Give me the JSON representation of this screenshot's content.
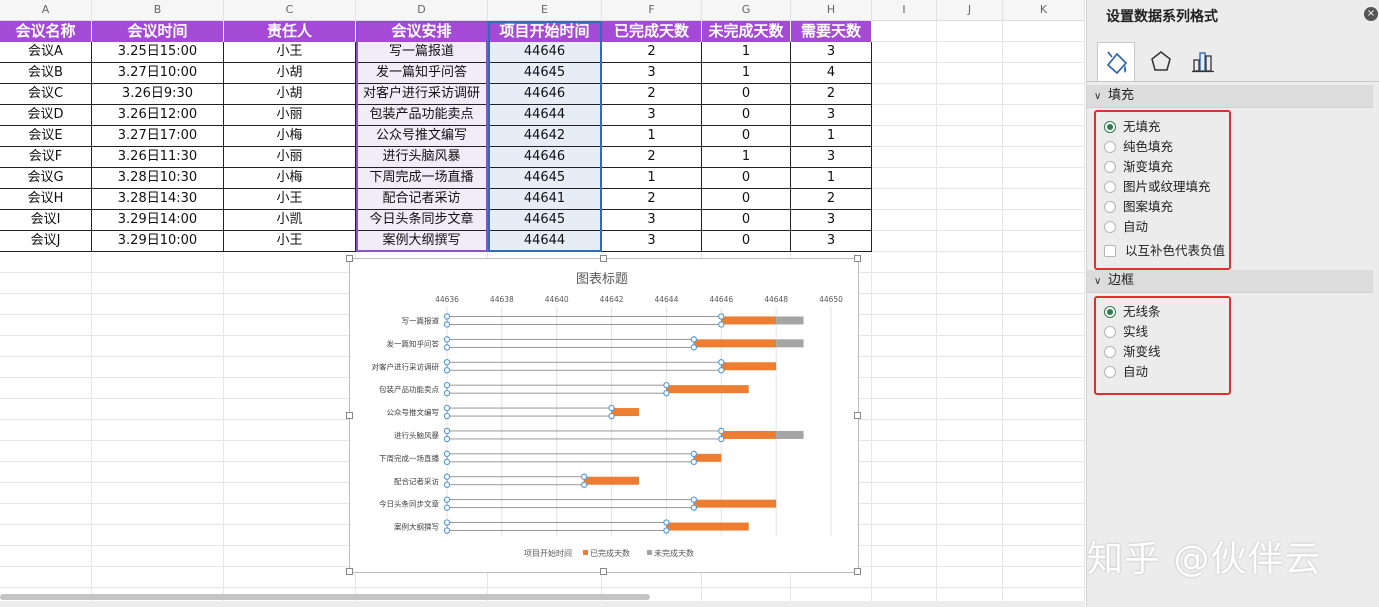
{
  "columns": [
    "A",
    "B",
    "C",
    "D",
    "E",
    "F",
    "G",
    "H",
    "I",
    "J",
    "K"
  ],
  "table": {
    "headers": [
      "会议名称",
      "会议时间",
      "责任人",
      "会议安排",
      "项目开始时间",
      "已完成天数",
      "未完成天数",
      "需要天数"
    ],
    "rows": [
      [
        "会议A",
        "3.25日15:00",
        "小王",
        "写一篇报道",
        "44646",
        "2",
        "1",
        "3"
      ],
      [
        "会议B",
        "3.27日10:00",
        "小胡",
        "发一篇知乎问答",
        "44645",
        "3",
        "1",
        "4"
      ],
      [
        "会议C",
        "3.26日9:30",
        "小胡",
        "对客户进行采访调研",
        "44646",
        "2",
        "0",
        "2"
      ],
      [
        "会议D",
        "3.26日12:00",
        "小丽",
        "包装产品功能卖点",
        "44644",
        "3",
        "0",
        "3"
      ],
      [
        "会议E",
        "3.27日17:00",
        "小梅",
        "公众号推文编写",
        "44642",
        "1",
        "0",
        "1"
      ],
      [
        "会议F",
        "3.26日11:30",
        "小丽",
        "进行头脑风暴",
        "44646",
        "2",
        "1",
        "3"
      ],
      [
        "会议G",
        "3.28日10:30",
        "小梅",
        "下周完成一场直播",
        "44645",
        "1",
        "0",
        "1"
      ],
      [
        "会议H",
        "3.28日14:30",
        "小王",
        "配合记者采访",
        "44641",
        "2",
        "0",
        "2"
      ],
      [
        "会议I",
        "3.29日14:00",
        "小凯",
        "今日头条同步文章",
        "44645",
        "3",
        "0",
        "3"
      ],
      [
        "会议J",
        "3.29日10:00",
        "小王",
        "案例大纲撰写",
        "44644",
        "3",
        "0",
        "3"
      ]
    ]
  },
  "chart_data": {
    "type": "bar",
    "orientation": "horizontal-stacked",
    "title": "图表标题",
    "categories": [
      "写一篇报道",
      "发一篇知乎问答",
      "对客户进行采访调研",
      "包装产品功能卖点",
      "公众号推文编写",
      "进行头脑风暴",
      "下周完成一场直播",
      "配合记者采访",
      "今日头条同步文章",
      "案例大纲撰写"
    ],
    "xlim": [
      44636,
      44650
    ],
    "xticks": [
      "44636",
      "44638",
      "44640",
      "44642",
      "44644",
      "44646",
      "44648",
      "44650"
    ],
    "grid": true,
    "legend_position": "bottom",
    "series": [
      {
        "name": "项目开始时间",
        "values": [
          44646,
          44645,
          44646,
          44644,
          44642,
          44646,
          44645,
          44641,
          44645,
          44644
        ],
        "fill": "none",
        "color": "#5b9bd5",
        "selected": true
      },
      {
        "name": "已完成天数",
        "values": [
          2,
          3,
          2,
          3,
          1,
          2,
          1,
          2,
          3,
          3
        ],
        "color": "#ed7d31"
      },
      {
        "name": "未完成天数",
        "values": [
          1,
          1,
          0,
          0,
          0,
          1,
          0,
          0,
          0,
          0
        ],
        "color": "#a5a5a5"
      }
    ]
  },
  "panel": {
    "title": "设置数据系列格式",
    "close_icon": "×",
    "tabs": [
      "fill-line-icon",
      "effects-icon",
      "series-options-icon"
    ],
    "fill_section": {
      "label": "填充",
      "options": [
        "无填充",
        "纯色填充",
        "渐变填充",
        "图片或纹理填充",
        "图案填充",
        "自动"
      ],
      "selected": "无填充",
      "invert_label": "以互补色代表负值"
    },
    "border_section": {
      "label": "边框",
      "options": [
        "无线条",
        "实线",
        "渐变线",
        "自动"
      ],
      "selected": "无线条"
    },
    "highlight_color": "#e0302d"
  },
  "watermark": "知乎 @伙伴云"
}
